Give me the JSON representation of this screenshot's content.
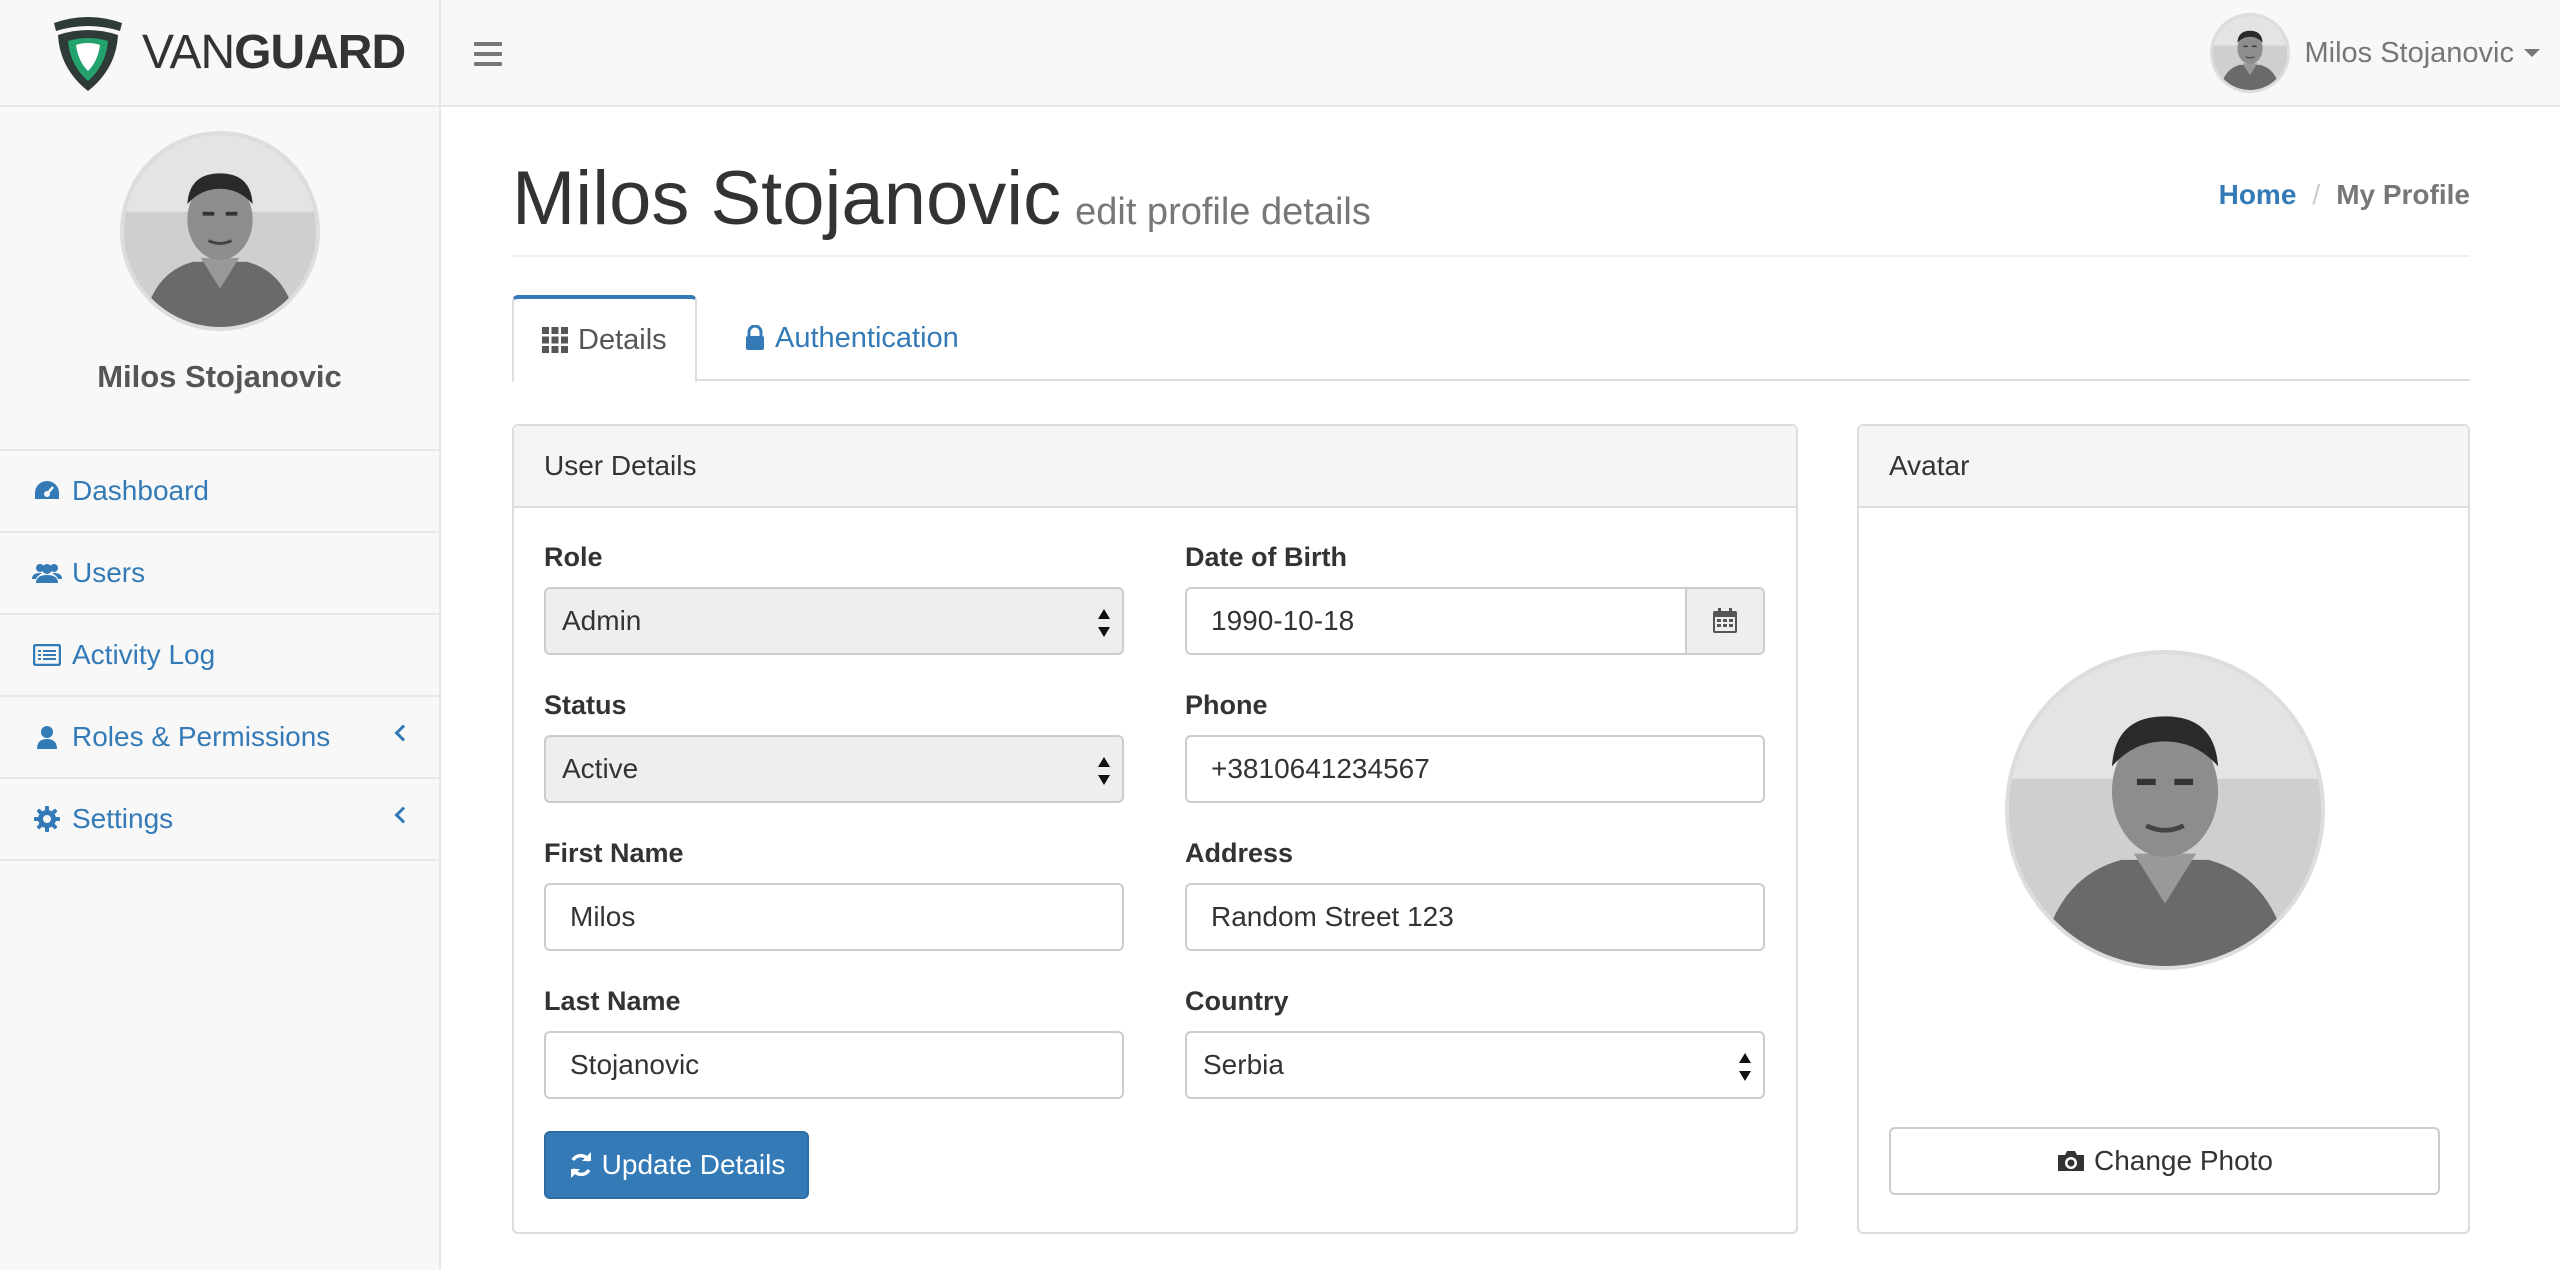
{
  "brand": {
    "text_light": "VAN",
    "text_bold": "GUARD"
  },
  "colors": {
    "accent": "#337ab7",
    "brand_green": "#23a26e",
    "brand_dark": "#2f3b39"
  },
  "header": {
    "user_name": "Milos Stojanovic"
  },
  "sidebar": {
    "user_name": "Milos Stojanovic",
    "items": [
      {
        "label": "Dashboard",
        "icon": "dashboard-icon"
      },
      {
        "label": "Users",
        "icon": "users-icon"
      },
      {
        "label": "Activity Log",
        "icon": "list-icon"
      },
      {
        "label": "Roles & Permissions",
        "icon": "user-icon"
      },
      {
        "label": "Settings",
        "icon": "gear-icon"
      }
    ]
  },
  "page": {
    "title": "Milos Stojanovic",
    "subtitle": "edit profile details",
    "breadcrumb": {
      "home": "Home",
      "separator": "/",
      "current": "My Profile"
    }
  },
  "tabs": {
    "details": "Details",
    "authentication": "Authentication"
  },
  "user_details": {
    "heading": "User Details",
    "role": {
      "label": "Role",
      "value": "Admin"
    },
    "status": {
      "label": "Status",
      "value": "Active"
    },
    "first_name": {
      "label": "First Name",
      "value": "Milos"
    },
    "last_name": {
      "label": "Last Name",
      "value": "Stojanovic"
    },
    "dob": {
      "label": "Date of Birth",
      "value": "1990-10-18"
    },
    "phone": {
      "label": "Phone",
      "value": "+3810641234567"
    },
    "address": {
      "label": "Address",
      "value": "Random Street 123"
    },
    "country": {
      "label": "Country",
      "value": "Serbia"
    },
    "update_button": "Update Details"
  },
  "avatar_panel": {
    "heading": "Avatar",
    "change_button": "Change Photo"
  }
}
